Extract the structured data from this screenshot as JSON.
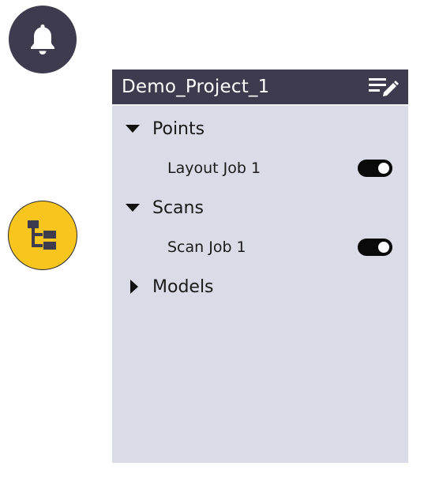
{
  "icons": {
    "notifications": "bell-icon",
    "tree": "hierarchy-tree-icon",
    "edit_list": "edit-list-icon"
  },
  "colors": {
    "header_bg": "#3d3b4d",
    "panel_bg": "#d9dce6",
    "accent_yellow": "#f7c51e",
    "toggle_on": "#0a0a0a"
  },
  "panel": {
    "title": "Demo_Project_1",
    "groups": [
      {
        "label": "Points",
        "expanded": true,
        "jobs": [
          {
            "label": "Layout Job 1",
            "visible": true
          }
        ]
      },
      {
        "label": "Scans",
        "expanded": true,
        "jobs": [
          {
            "label": "Scan Job 1",
            "visible": true
          }
        ]
      },
      {
        "label": "Models",
        "expanded": false,
        "jobs": []
      }
    ]
  }
}
